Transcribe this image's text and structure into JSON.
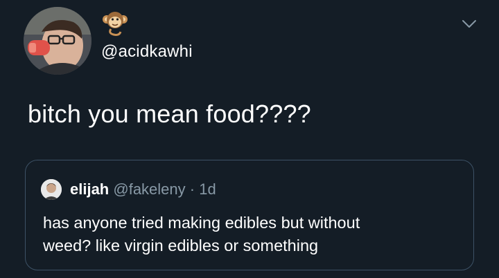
{
  "tweet": {
    "author_handle": "@acidkawhi",
    "author_emoji": "monkey-emoji",
    "text": "bitch you mean food????",
    "more_icon": "chevron-down-icon"
  },
  "quoted_tweet": {
    "display_name": "elijah",
    "handle": "@fakeleny",
    "separator": "·",
    "time": "1d",
    "text_lines": [
      "has anyone tried making edibles but without",
      "weed? like virgin edibles or something"
    ]
  },
  "colors": {
    "background": "#141d26",
    "text_primary": "#ffffff",
    "text_secondary": "#8899a6",
    "border": "#3d5266"
  }
}
